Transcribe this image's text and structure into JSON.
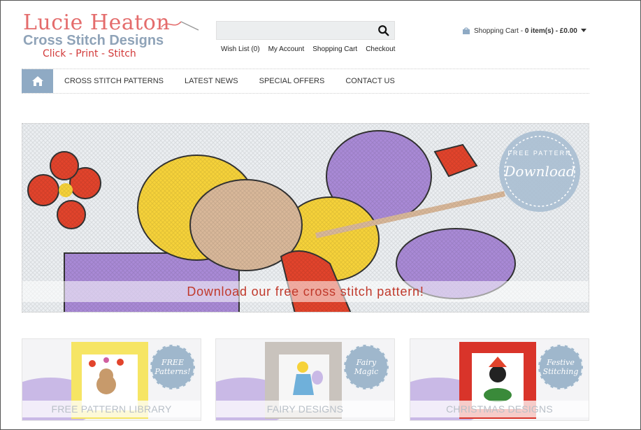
{
  "logo": {
    "title": "Lucie Heaton",
    "subtitle": "Cross Stitch Designs",
    "tagline": "Click  -  Print  -  Stitch"
  },
  "search": {
    "placeholder": "",
    "value": "",
    "icon": "search-icon"
  },
  "top_links": [
    "Wish List (0)",
    "My Account",
    "Shopping Cart",
    "Checkout"
  ],
  "cart": {
    "label": "Shopping Cart - ",
    "summary": "0 item(s) - £0.00",
    "icon": "basket-icon"
  },
  "nav": {
    "home_icon": "home-icon",
    "items": [
      "CROSS STITCH PATTERNS",
      "LATEST NEWS",
      "SPECIAL OFFERS",
      "CONTACT US"
    ]
  },
  "banner": {
    "caption": "Download our free cross stitch pattern!",
    "badge_top": "FREE PATTERN",
    "badge_main": "Download"
  },
  "tiles": [
    {
      "label": "FREE PATTERN LIBRARY",
      "badge": "FREE Patterns!"
    },
    {
      "label": "FAIRY DESIGNS",
      "badge": "Fairy Magic"
    },
    {
      "label": "CHRISTMAS DESIGNS",
      "badge": "Festive Stitching"
    }
  ],
  "colors": {
    "brand_red": "#e46c6c",
    "brand_blue": "#8fa3b8",
    "nav_home": "#8faac4",
    "caption": "#c0392b"
  }
}
